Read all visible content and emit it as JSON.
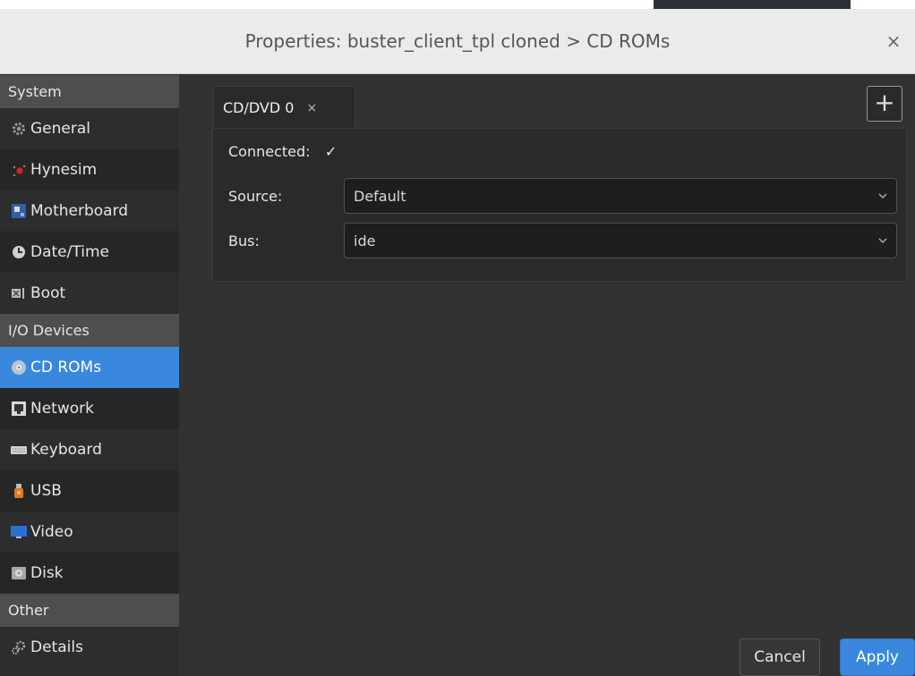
{
  "window": {
    "title": "Properties: buster_client_tpl cloned > CD ROMs",
    "close_glyph": "×"
  },
  "sidebar": {
    "sections": [
      {
        "header": "System",
        "items": [
          "General",
          "Hynesim",
          "Motherboard",
          "Date/Time",
          "Boot"
        ]
      },
      {
        "header": "I/O Devices",
        "items": [
          "CD ROMs",
          "Network",
          "Keyboard",
          "USB",
          "Video",
          "Disk"
        ]
      },
      {
        "header": "Other",
        "items": [
          "Details"
        ]
      }
    ],
    "selected": "CD ROMs"
  },
  "tabs": [
    {
      "label": "CD/DVD 0",
      "close_glyph": "×"
    }
  ],
  "add_tab_glyph": "+",
  "form": {
    "connected_label": "Connected:",
    "connected_checked": true,
    "check_glyph": "✓",
    "source_label": "Source:",
    "source_value": "Default",
    "bus_label": "Bus:",
    "bus_value": "ide"
  },
  "buttons": {
    "cancel": "Cancel",
    "apply": "Apply"
  },
  "colors": {
    "accent": "#3a88dd",
    "panel": "#2a2a2a",
    "sidebar": "#2d2d2d",
    "header": "#4e4e4e"
  }
}
